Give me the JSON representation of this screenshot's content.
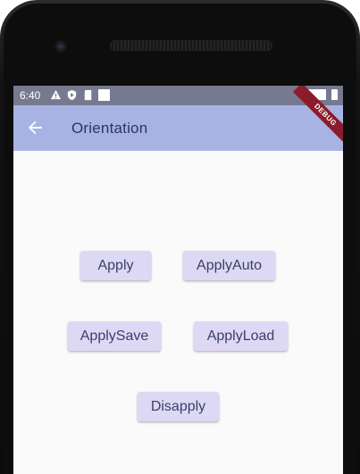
{
  "statusbar": {
    "time": "6:40"
  },
  "appbar": {
    "title": "Orientation",
    "debug_label": "DEBUG"
  },
  "buttons": {
    "apply": "Apply",
    "apply_auto": "ApplyAuto",
    "apply_save": "ApplySave",
    "apply_load": "ApplyLoad",
    "disapply": "Disapply"
  },
  "colors": {
    "statusbar": "#767a90",
    "appbar": "#a7b4e3",
    "button_bg": "#ddd9f5",
    "screen_bg": "#fafafa"
  }
}
